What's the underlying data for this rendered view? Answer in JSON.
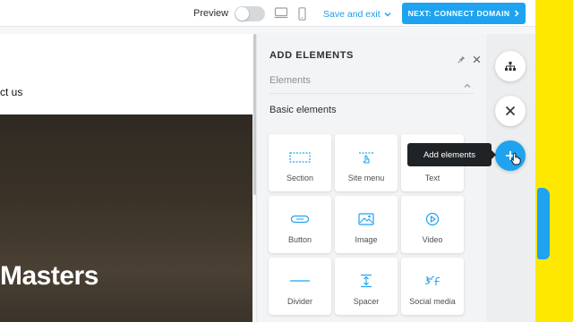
{
  "topbar": {
    "preview_label": "Preview",
    "save_exit_label": "Save and exit",
    "next_label": "NEXT: CONNECT DOMAIN"
  },
  "canvas": {
    "nav_text": "ct us",
    "hero_title": "Masters"
  },
  "panel": {
    "title": "ADD ELEMENTS",
    "section_label": "Elements",
    "sub_label": "Basic elements",
    "tiles": [
      {
        "label": "Section",
        "icon": "section-icon"
      },
      {
        "label": "Site menu",
        "icon": "site-menu-icon"
      },
      {
        "label": "Text",
        "icon": "text-icon"
      },
      {
        "label": "Button",
        "icon": "button-icon"
      },
      {
        "label": "Image",
        "icon": "image-icon"
      },
      {
        "label": "Video",
        "icon": "video-icon"
      },
      {
        "label": "Divider",
        "icon": "divider-icon"
      },
      {
        "label": "Spacer",
        "icon": "spacer-icon"
      },
      {
        "label": "Social media",
        "icon": "social-media-icon"
      }
    ]
  },
  "tooltip": {
    "text": "Add elements"
  },
  "colors": {
    "accent": "#1fa3f0",
    "yellow": "#ffe800",
    "dark": "#1f2326"
  }
}
